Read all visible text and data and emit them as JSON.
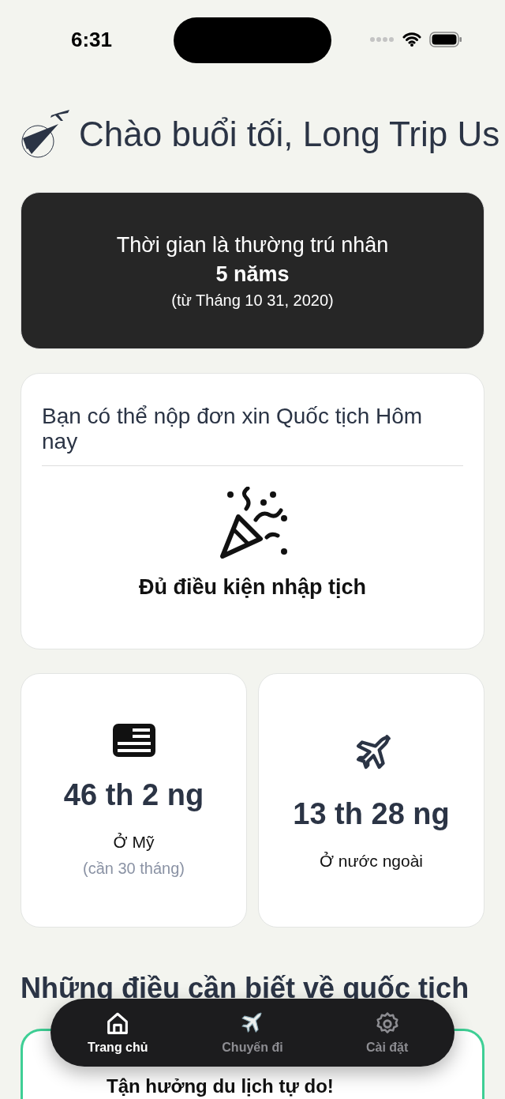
{
  "status_bar": {
    "time": "6:31"
  },
  "header": {
    "greeting": "Chào buổi tối, Long Trip Us"
  },
  "residency_card": {
    "label": "Thời gian là thường trú nhân",
    "duration": "5 năms",
    "since": "(từ Tháng 10 31, 2020)"
  },
  "eligibility_card": {
    "title": "Bạn có thể nộp đơn xin Quốc tịch Hôm nay",
    "status": "Đủ điều kiện nhập tịch"
  },
  "stats": [
    {
      "kind": "flag",
      "value": "46 th 2 ng",
      "label": "Ở Mỹ",
      "note": "(cần 30 tháng)"
    },
    {
      "kind": "plane",
      "value": "13 th 28 ng",
      "label": "Ở nước ngoài"
    }
  ],
  "section": {
    "title": "Những điều cần biết về quốc tịch"
  },
  "info_card": {
    "title": "Tận hưởng du lịch tự do!"
  },
  "tab_bar": [
    {
      "kind": "home",
      "label": "Trang chủ",
      "selected": true
    },
    {
      "kind": "trips",
      "label": "Chuyến đi",
      "selected": false
    },
    {
      "kind": "settings",
      "label": "Cài đặt",
      "selected": false
    }
  ]
}
